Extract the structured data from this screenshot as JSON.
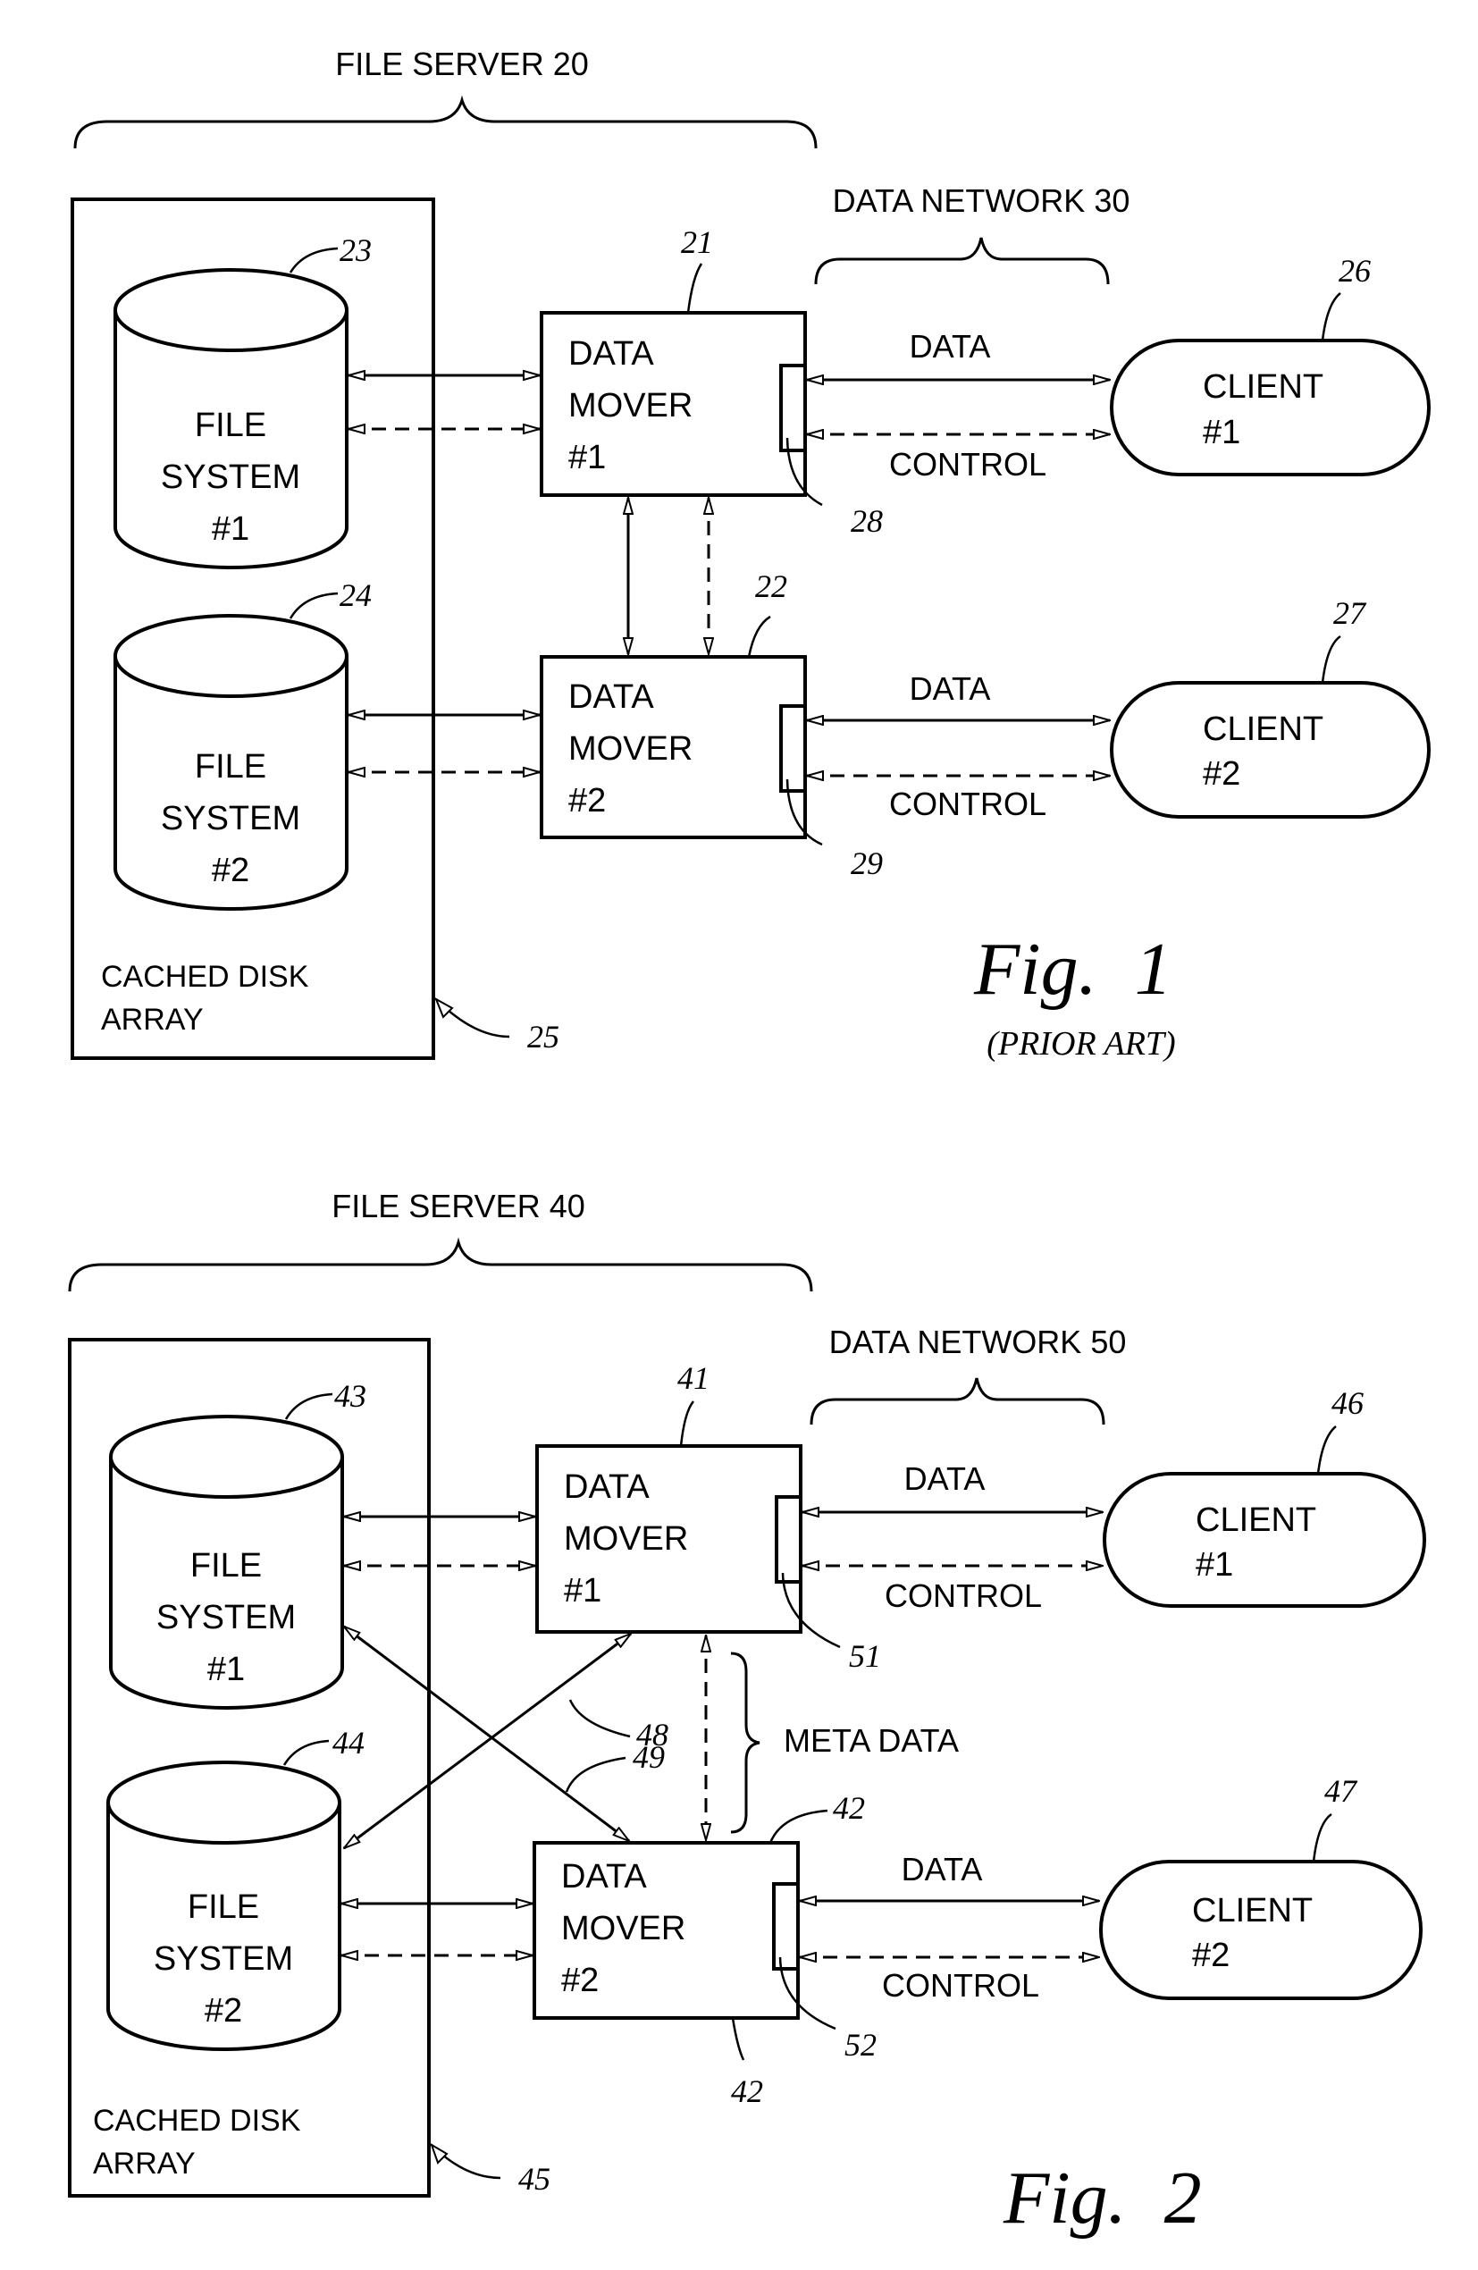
{
  "figures": [
    {
      "id": "fig1",
      "caption": "Fig.  1",
      "subcaption": "(PRIOR ART)",
      "file_server_label": "FILE SERVER 20",
      "data_network_label": "DATA NETWORK 30",
      "disk_array": {
        "label_line1": "CACHED DISK",
        "label_line2": "ARRAY",
        "ref": "25"
      },
      "file_systems": [
        {
          "line1": "FILE",
          "line2": "SYSTEM",
          "line3": "#1",
          "ref": "23"
        },
        {
          "line1": "FILE",
          "line2": "SYSTEM",
          "line3": "#2",
          "ref": "24"
        }
      ],
      "data_movers": [
        {
          "line1": "DATA",
          "line2": "MOVER",
          "line3": "#1",
          "ref": "21",
          "port_ref": "28"
        },
        {
          "line1": "DATA",
          "line2": "MOVER",
          "line3": "#2",
          "ref": "22",
          "port_ref": "29"
        }
      ],
      "clients": [
        {
          "line1": "CLIENT",
          "line2": "#1",
          "ref": "26"
        },
        {
          "line1": "CLIENT",
          "line2": "#2",
          "ref": "27"
        }
      ],
      "link_labels": {
        "data": "DATA",
        "control": "CONTROL"
      }
    },
    {
      "id": "fig2",
      "caption": "Fig.  2",
      "file_server_label": "FILE SERVER 40",
      "data_network_label": "DATA NETWORK 50",
      "disk_array": {
        "label_line1": "CACHED DISK",
        "label_line2": "ARRAY",
        "ref": "45"
      },
      "file_systems": [
        {
          "line1": "FILE",
          "line2": "SYSTEM",
          "line3": "#1",
          "ref": "43"
        },
        {
          "line1": "FILE",
          "line2": "SYSTEM",
          "line3": "#2",
          "ref": "44"
        }
      ],
      "data_movers": [
        {
          "line1": "DATA",
          "line2": "MOVER",
          "line3": "#1",
          "ref": "41",
          "port_ref": "51"
        },
        {
          "line1": "DATA",
          "line2": "MOVER",
          "line3": "#2",
          "ref": "42",
          "port_ref": "52",
          "ref_bottom": "42"
        }
      ],
      "clients": [
        {
          "line1": "CLIENT",
          "line2": "#1",
          "ref": "46"
        },
        {
          "line1": "CLIENT",
          "line2": "#2",
          "ref": "47"
        }
      ],
      "cross_links": {
        "ref_a": "48",
        "ref_b": "49"
      },
      "meta_data_label": "META DATA",
      "link_labels": {
        "data": "DATA",
        "control": "CONTROL"
      }
    }
  ]
}
